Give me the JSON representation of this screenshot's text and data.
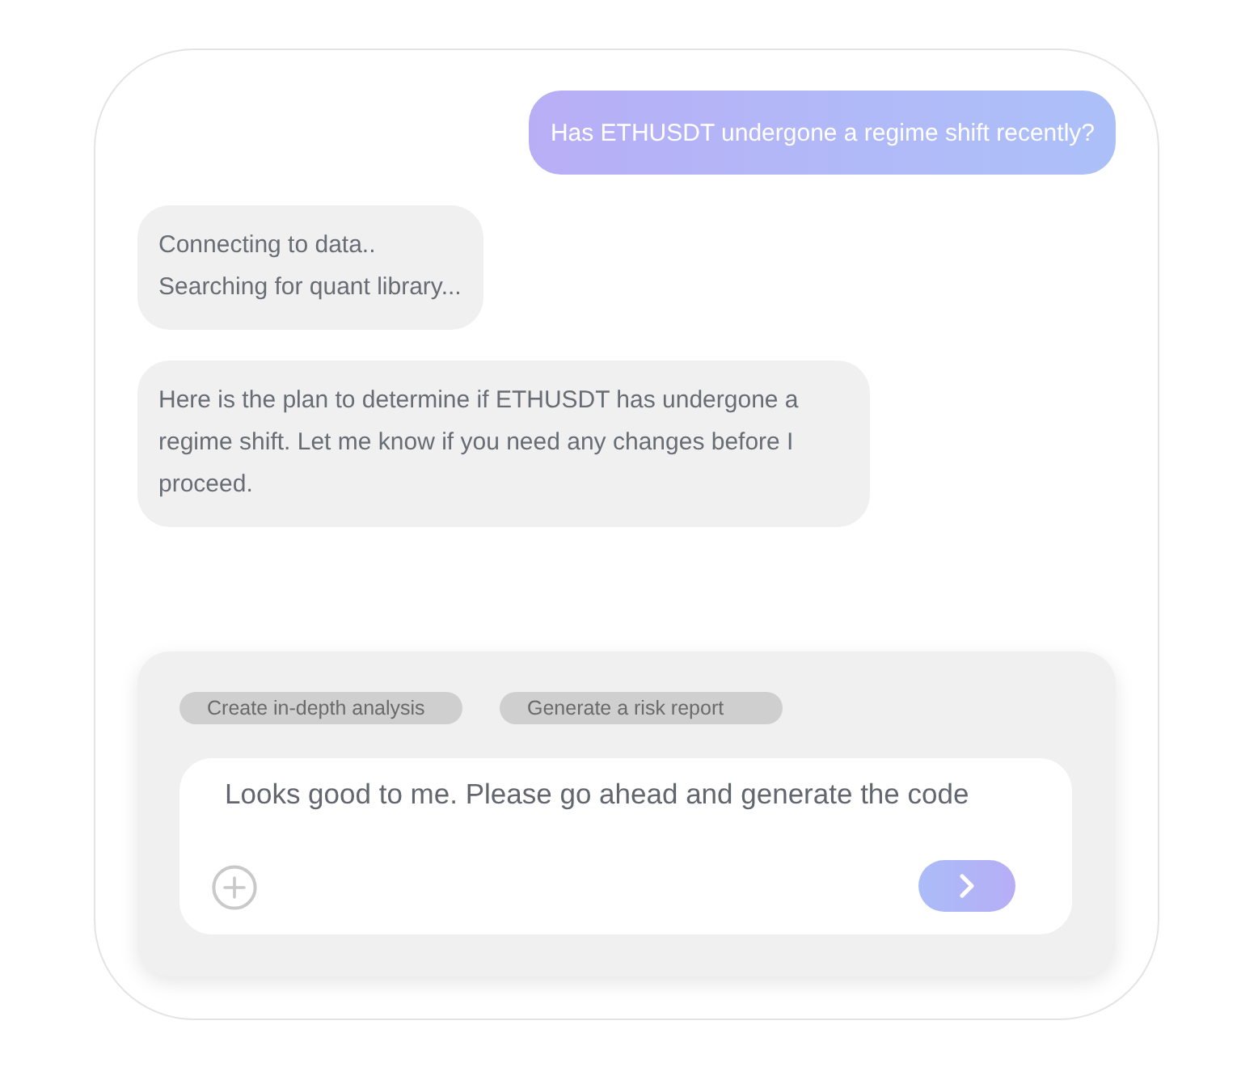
{
  "messages": [
    {
      "kind": "sent",
      "lines": [
        "Has ETHUSDT undergone a regime shift recently?"
      ]
    },
    {
      "kind": "received",
      "lines": [
        "Connecting to data..",
        "Searching for quant library..."
      ]
    },
    {
      "kind": "received",
      "lines": [
        "Here is the plan to determine if ETHUSDT has undergone a regime shift. Let me know if you need any changes before I proceed."
      ]
    }
  ],
  "suggestions": [
    "Create in-depth analysis",
    "Generate a risk report"
  ],
  "composer": {
    "value": "Looks good to me. Please go ahead and generate the code"
  }
}
